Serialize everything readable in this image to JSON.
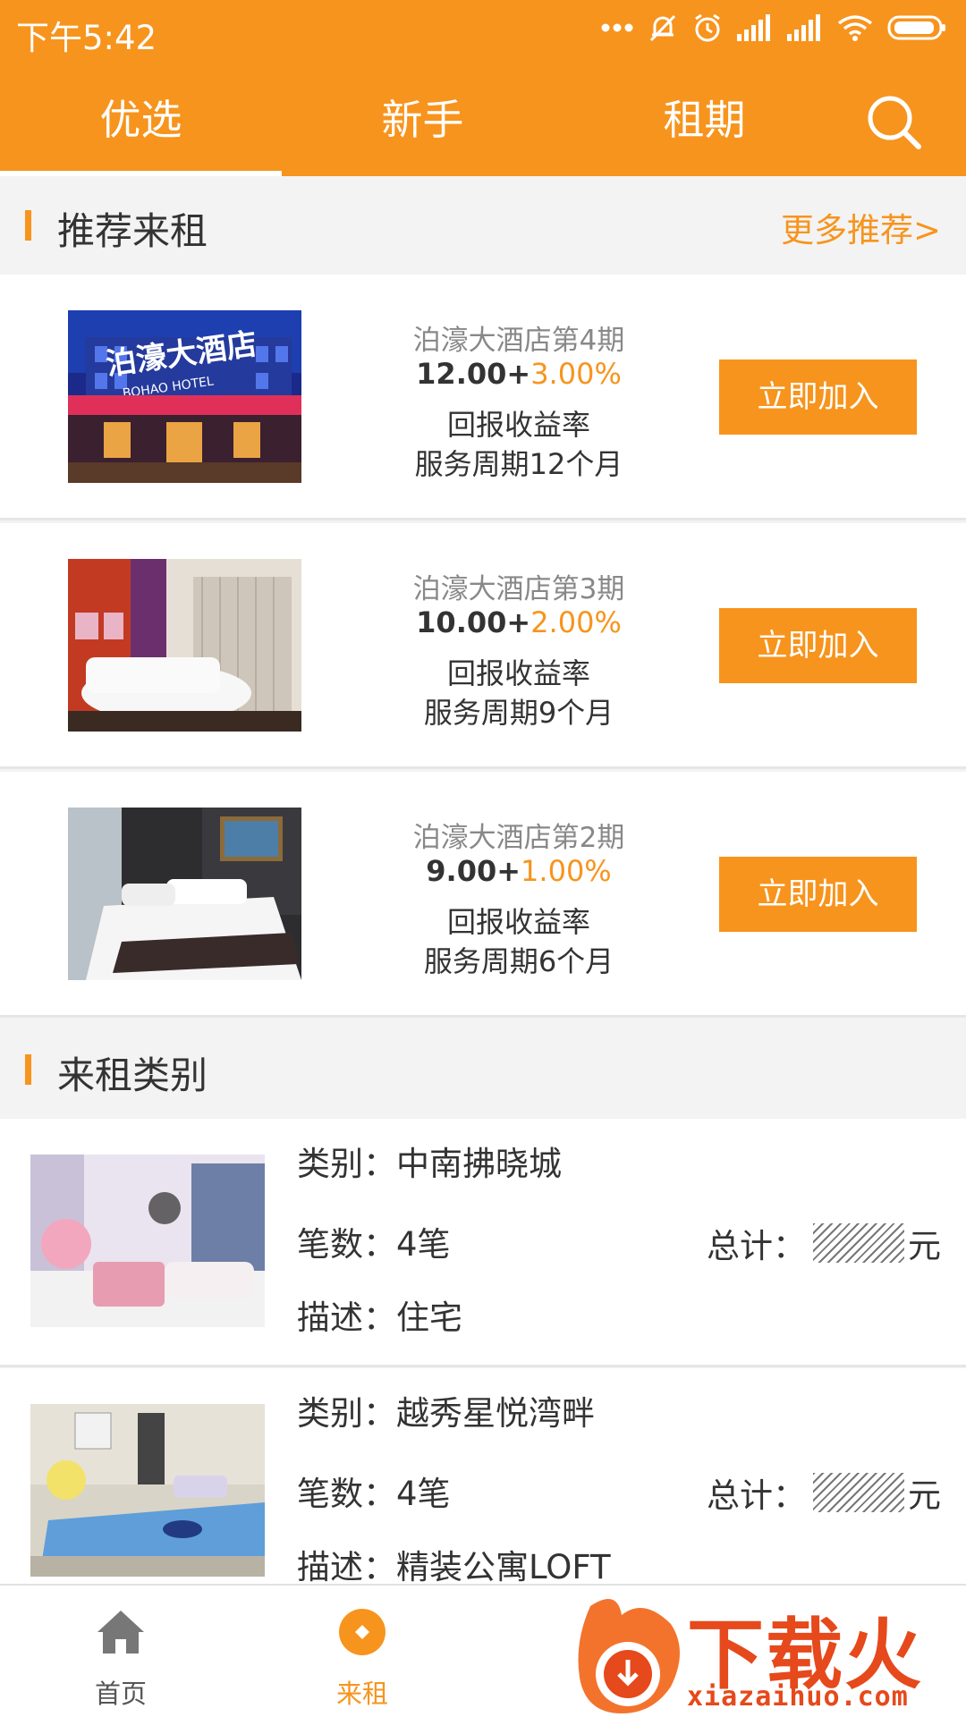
{
  "status_bar": {
    "time": "下午5:42"
  },
  "tabs": [
    {
      "label": "优选",
      "active": true
    },
    {
      "label": "新手",
      "active": false
    },
    {
      "label": "租期",
      "active": false
    }
  ],
  "recommend": {
    "title": "推荐来租",
    "more": "更多推荐>",
    "items": [
      {
        "name": "泊濠大酒店第4期",
        "rate_base": "12.00+",
        "rate_plus": "3.00%",
        "rate_label": "回报收益率",
        "period": "服务周期12个月",
        "button": "立即加入"
      },
      {
        "name": "泊濠大酒店第3期",
        "rate_base": "10.00+",
        "rate_plus": "2.00%",
        "rate_label": "回报收益率",
        "period": "服务周期9个月",
        "button": "立即加入"
      },
      {
        "name": "泊濠大酒店第2期",
        "rate_base": "9.00+",
        "rate_plus": "1.00%",
        "rate_label": "回报收益率",
        "period": "服务周期6个月",
        "button": "立即加入"
      }
    ],
    "hotel_sign": "泊濠大酒店",
    "hotel_sign_en": "BOHAO HOTEL"
  },
  "categories": {
    "title": "来租类别",
    "items": [
      {
        "category": "类别：中南拂晓城",
        "count": "笔数：4笔",
        "total_label": "总计：",
        "total_unit": "元",
        "desc": "描述：住宅"
      },
      {
        "category": "类别：越秀星悦湾畔",
        "count": "笔数：4笔",
        "total_label": "总计：",
        "total_unit": "元",
        "desc": "描述：精装公寓LOFT"
      }
    ]
  },
  "bottom_nav": [
    {
      "label": "首页",
      "icon": "home-icon"
    },
    {
      "label": "来租",
      "icon": "rent-icon",
      "active": true
    }
  ],
  "watermark": {
    "text": "下载火",
    "sub": "xiazaihuo.com"
  },
  "colors": {
    "accent": "#f7941d",
    "watermark": "#e6491b"
  }
}
